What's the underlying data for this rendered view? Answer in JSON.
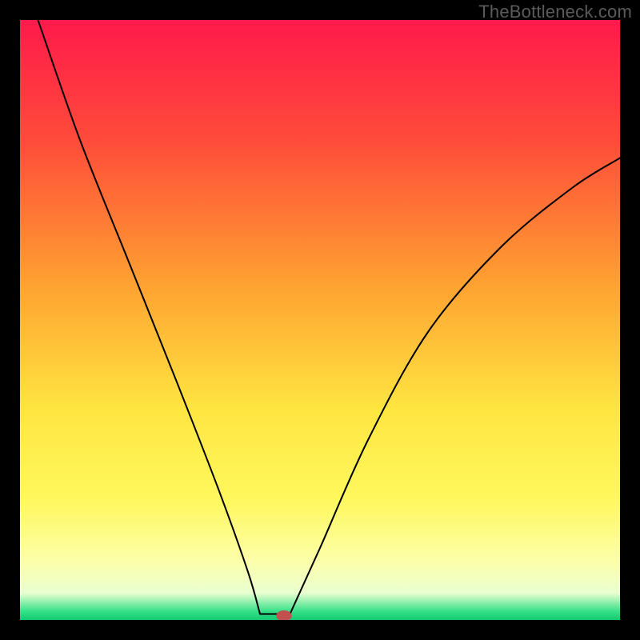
{
  "watermark": "TheBottleneck.com",
  "chart_data": {
    "type": "line",
    "title": "",
    "xlabel": "",
    "ylabel": "",
    "xlim": [
      0,
      100
    ],
    "ylim": [
      0,
      100
    ],
    "gradient_stops": [
      {
        "offset": 0.0,
        "color": "#ff1a4b"
      },
      {
        "offset": 0.2,
        "color": "#ff4b3a"
      },
      {
        "offset": 0.45,
        "color": "#ffa531"
      },
      {
        "offset": 0.65,
        "color": "#ffe641"
      },
      {
        "offset": 0.8,
        "color": "#fff85e"
      },
      {
        "offset": 0.9,
        "color": "#fdffa8"
      },
      {
        "offset": 0.955,
        "color": "#eaffd0"
      },
      {
        "offset": 0.985,
        "color": "#38e28b"
      },
      {
        "offset": 1.0,
        "color": "#12c86e"
      }
    ],
    "curve": {
      "left_branch": [
        {
          "x": 3,
          "y": 100
        },
        {
          "x": 10,
          "y": 80
        },
        {
          "x": 18,
          "y": 60
        },
        {
          "x": 26,
          "y": 40
        },
        {
          "x": 33,
          "y": 22
        },
        {
          "x": 38,
          "y": 8
        },
        {
          "x": 40,
          "y": 1
        }
      ],
      "flat": [
        {
          "x": 40,
          "y": 1
        },
        {
          "x": 45,
          "y": 1
        }
      ],
      "right_branch": [
        {
          "x": 45,
          "y": 1
        },
        {
          "x": 50,
          "y": 12
        },
        {
          "x": 58,
          "y": 30
        },
        {
          "x": 68,
          "y": 48
        },
        {
          "x": 80,
          "y": 62
        },
        {
          "x": 92,
          "y": 72
        },
        {
          "x": 100,
          "y": 77
        }
      ]
    },
    "marker": {
      "x": 44,
      "y": 0.7,
      "color": "#c0514e"
    }
  }
}
